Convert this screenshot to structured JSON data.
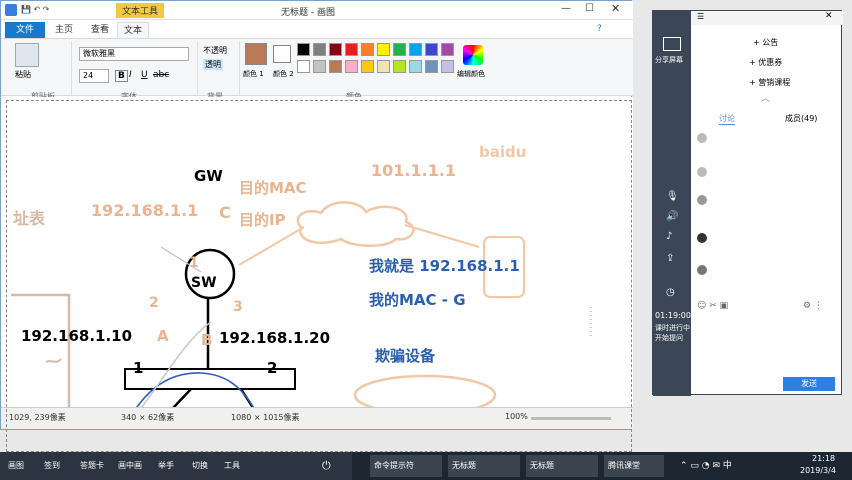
{
  "paint": {
    "title": "无标题 - 画图",
    "quick_label": "文本工具",
    "tabs": [
      "文件",
      "主页",
      "查看",
      "文本"
    ],
    "clipboard": {
      "paste": "粘贴",
      "group": "剪贴板"
    },
    "font": {
      "family": "微软雅黑",
      "size": "24",
      "group": "字体"
    },
    "background": {
      "opaque": "不透明",
      "transparent": "透明",
      "group": "背景"
    },
    "colors": {
      "color1": "颜色 1",
      "color2": "颜色 2",
      "edit": "编辑颜色",
      "group": "颜色"
    },
    "palette": [
      "#000000",
      "#7f7f7f",
      "#880015",
      "#ed1c24",
      "#ff7f27",
      "#fff200",
      "#22b14c",
      "#00a2e8",
      "#3f48cc",
      "#a349a4",
      "#ffffff",
      "#c3c3c3",
      "#b97a57",
      "#ffaec9",
      "#ffc90e",
      "#efe4b0",
      "#b5e61d",
      "#99d9ea",
      "#7092be",
      "#c8bfe7"
    ],
    "status": {
      "pos": "1029, 239像素",
      "sel": "340 × 62像素",
      "size": "1080 × 1015像素",
      "zoom": "100%"
    }
  },
  "drawing": {
    "gw": "GW",
    "baidu": "baidu",
    "dest_mac": "目的MAC",
    "dest_ip": "目的IP",
    "gw_ip": "192.168.1.1",
    "c": "C",
    "ext_ip": "101.1.1.1",
    "table_label": "址表",
    "sw": "SW",
    "n1": "1",
    "n2": "2",
    "n3": "3",
    "ip_a": "192.168.1.10",
    "a": "A",
    "ip_b": "192.168.1.20",
    "b": "B",
    "host1": "1",
    "host2": "2",
    "claim_ip": "我就是 192.168.1.1",
    "claim_mac": "我的MAC - G",
    "spoof": "欺骗设备"
  },
  "panel": {
    "share": "分享屏幕",
    "menu": [
      "公告",
      "优惠券",
      "营销课程"
    ],
    "tab_chat": "讨论",
    "tab_members": "成员(49)",
    "timer": "01:19:00",
    "timer_sub": "课时进行中",
    "timer_sub2": "开始提问",
    "send": "发送"
  },
  "taskbar": {
    "items": [
      "画图",
      "签到",
      "答题卡",
      "画中画",
      "举手",
      "切换",
      "工具"
    ],
    "apps": [
      "命令提示符",
      "无标题",
      "无标题",
      "腾讯课堂"
    ],
    "time": "21:18",
    "date": "2019/3/4",
    "note": "腾讯课堂"
  }
}
